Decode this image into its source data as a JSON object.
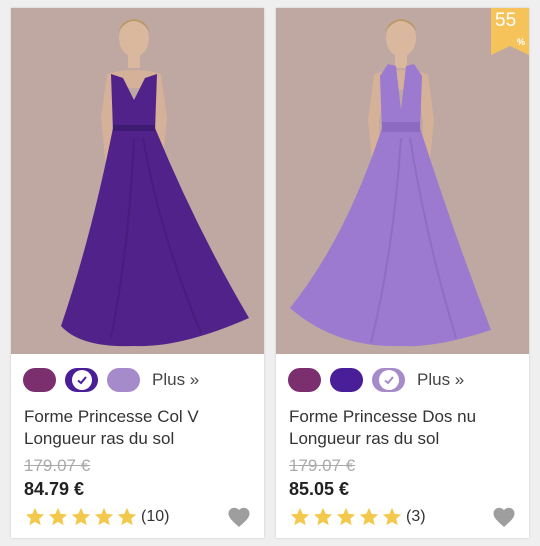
{
  "products": [
    {
      "title_line1": "Forme Princesse Col V",
      "title_line2": "Longueur ras du sol",
      "old_price": "179.07 €",
      "price": "84.79 €",
      "rating_count": "(10)",
      "stars": 5,
      "more_colors_label": "Plus »",
      "swatch_colors": [
        "#7b2f6f",
        "#4a1e98",
        "#a58bc9"
      ],
      "selected_swatch": 1,
      "dress_color": "#50228a",
      "wishlist_icon": "heart-icon"
    },
    {
      "title_line1": "Forme Princesse Dos nu",
      "title_line2": "Longueur ras du sol",
      "old_price": "179.07 €",
      "price": "85.05 €",
      "rating_count": "(3)",
      "stars": 5,
      "more_colors_label": "Plus »",
      "swatch_colors": [
        "#7b2f6f",
        "#4a1e98",
        "#a58bc9"
      ],
      "selected_swatch": 2,
      "dress_color": "#9c7ad0",
      "discount_value": "55",
      "discount_symbol": "%",
      "wishlist_icon": "heart-icon"
    }
  ],
  "colors": {
    "star": "#f2c94c",
    "heart": "#9e9e9e",
    "badge": "#f5c35a",
    "photo_bg": "#bfa8a1"
  }
}
